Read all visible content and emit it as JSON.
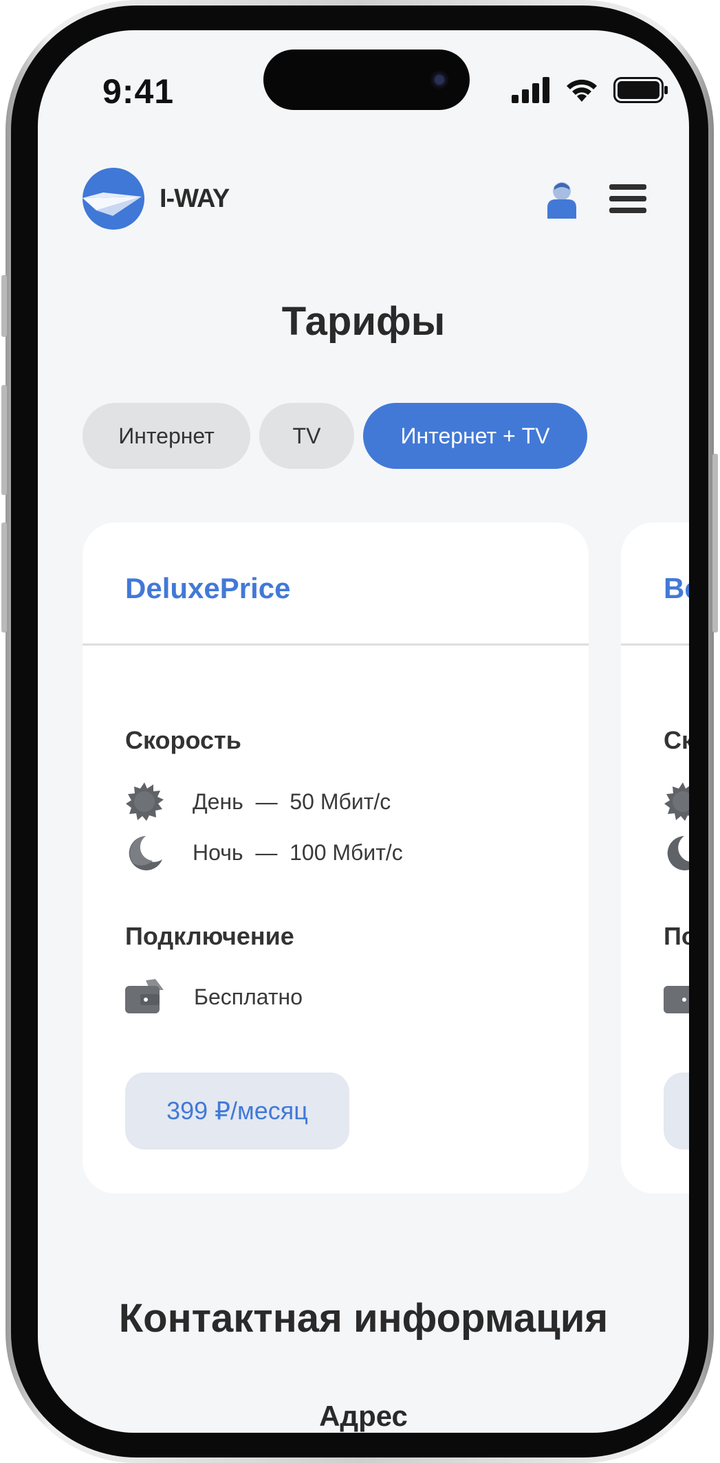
{
  "status_bar": {
    "time": "9:41"
  },
  "header": {
    "brand": "I-WAY",
    "user_icon": "user-icon",
    "menu_icon": "hamburger-menu-icon"
  },
  "page": {
    "title": "Тарифы"
  },
  "tabs": [
    {
      "label": "Интернет",
      "active": false
    },
    {
      "label": "TV",
      "active": false
    },
    {
      "label": "Интернет + TV",
      "active": true
    }
  ],
  "cards": [
    {
      "title": "DeluxePrice",
      "speed_heading": "Скорость",
      "day_speed": "День  —  50 Мбит/с",
      "night_speed": "Ночь  —  100 Мбит/с",
      "connection_heading": "Подключение",
      "connection_value": "Бесплатно",
      "price": "399 ₽/месяц"
    },
    {
      "title": "Be",
      "speed_heading": "Ск",
      "connection_heading": "По"
    }
  ],
  "contact": {
    "title": "Контактная информация",
    "address_heading": "Адрес"
  },
  "colors": {
    "accent": "#4279d6",
    "background": "#f5f6f8",
    "card": "#ffffff",
    "tab_inactive": "#e1e2e4",
    "price_bg": "#e3e8f1"
  }
}
